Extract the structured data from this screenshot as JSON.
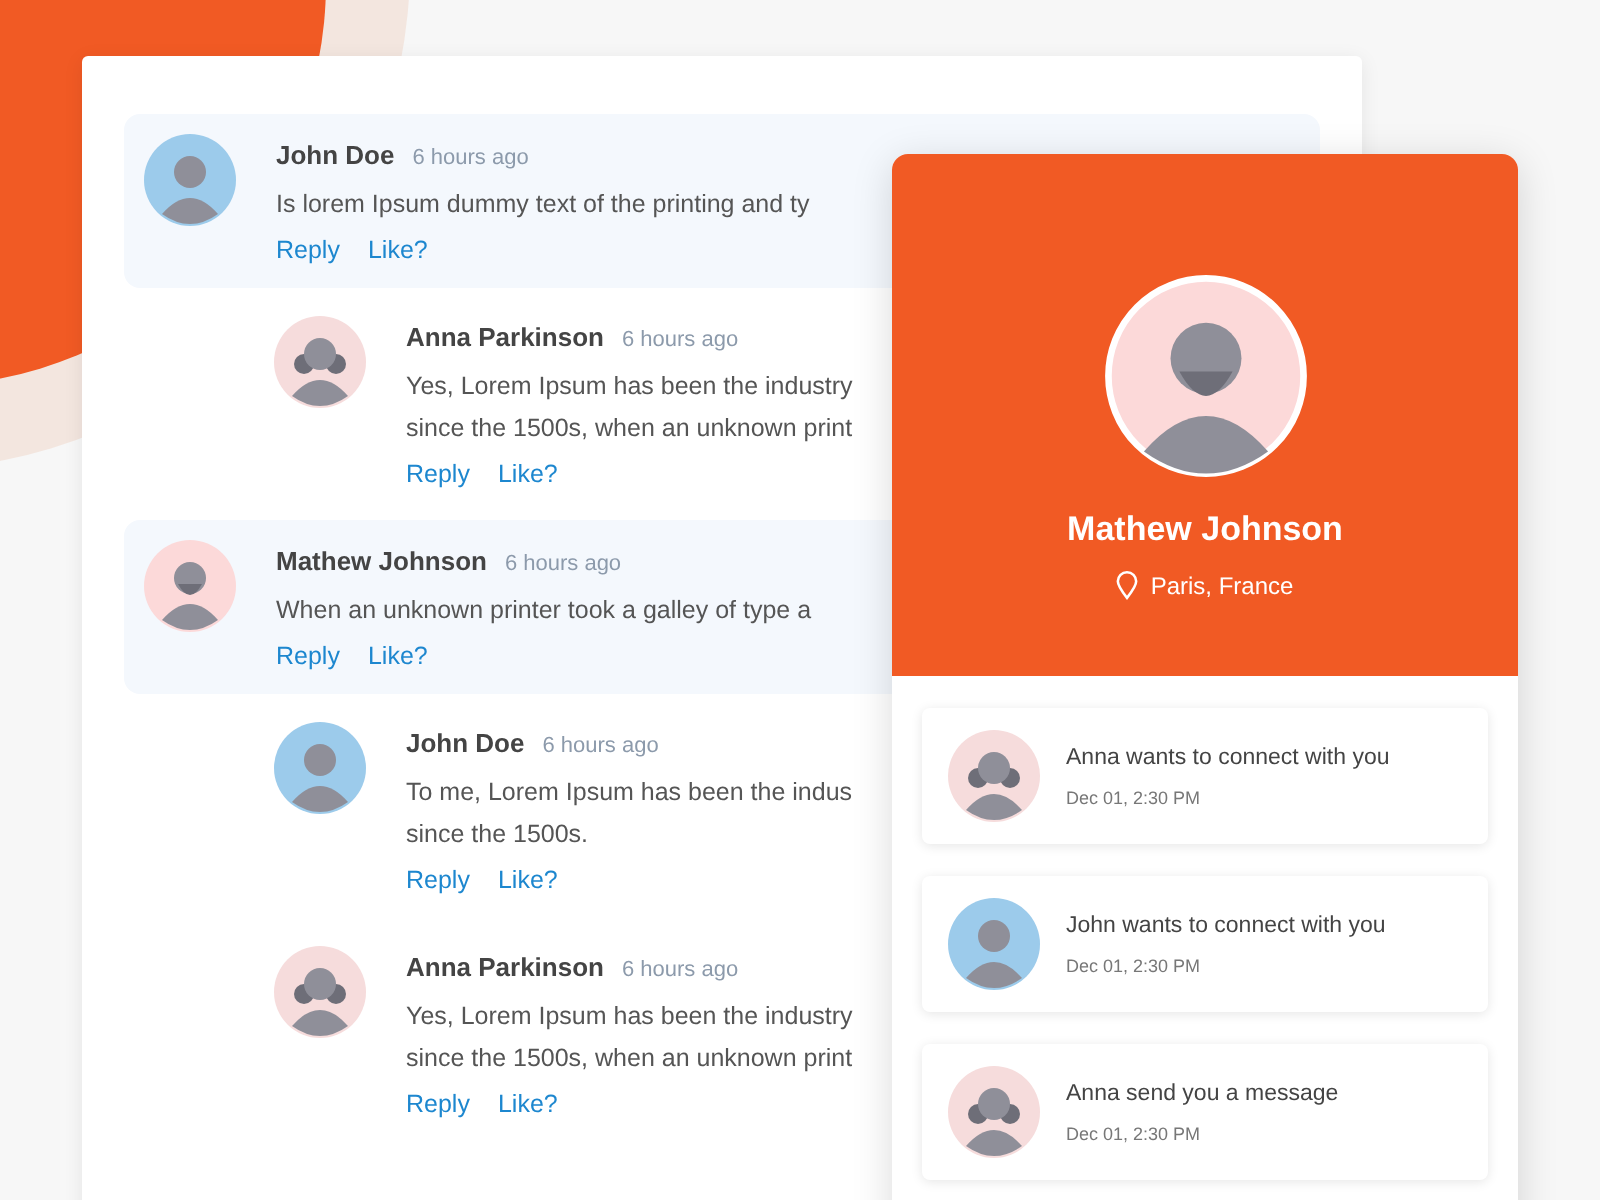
{
  "comments": [
    {
      "author": "John Doe",
      "time": "6 hours ago",
      "lines": [
        "Is lorem Ipsum dummy text of the printing and ty"
      ],
      "kind": "boy",
      "actions": [
        "Reply",
        "Like?"
      ],
      "replies": [
        {
          "author": "Anna Parkinson",
          "time": "6 hours ago",
          "lines": [
            "Yes, Lorem Ipsum has been the industry",
            "since the 1500s, when an unknown print"
          ],
          "kind": "girl",
          "actions": [
            "Reply",
            "Like?"
          ]
        }
      ]
    },
    {
      "author": "Mathew Johnson",
      "time": "6 hours ago",
      "lines": [
        "When an unknown printer took a galley of type a"
      ],
      "kind": "bearded",
      "actions": [
        "Reply",
        "Like?"
      ],
      "replies": [
        {
          "author": "John Doe",
          "time": "6 hours ago",
          "lines": [
            "To me, Lorem Ipsum has been the indus",
            "since the 1500s."
          ],
          "kind": "boy",
          "actions": [
            "Reply",
            "Like?"
          ]
        },
        {
          "author": "Anna Parkinson",
          "time": "6 hours ago",
          "lines": [
            "Yes, Lorem Ipsum has been the industry",
            "since the 1500s, when an unknown print"
          ],
          "kind": "girl",
          "actions": [
            "Reply",
            "Like?"
          ]
        }
      ]
    }
  ],
  "profile": {
    "name": "Mathew Johnson",
    "location": "Paris, France",
    "kind": "bearded"
  },
  "notifications": [
    {
      "text": "Anna wants to connect with you",
      "time": "Dec 01, 2:30 PM",
      "kind": "girl"
    },
    {
      "text": "John wants to connect with you",
      "time": "Dec 01, 2:30 PM",
      "kind": "boy"
    },
    {
      "text": "Anna send you a message",
      "time": "Dec 01, 2:30 PM",
      "kind": "girl"
    }
  ]
}
